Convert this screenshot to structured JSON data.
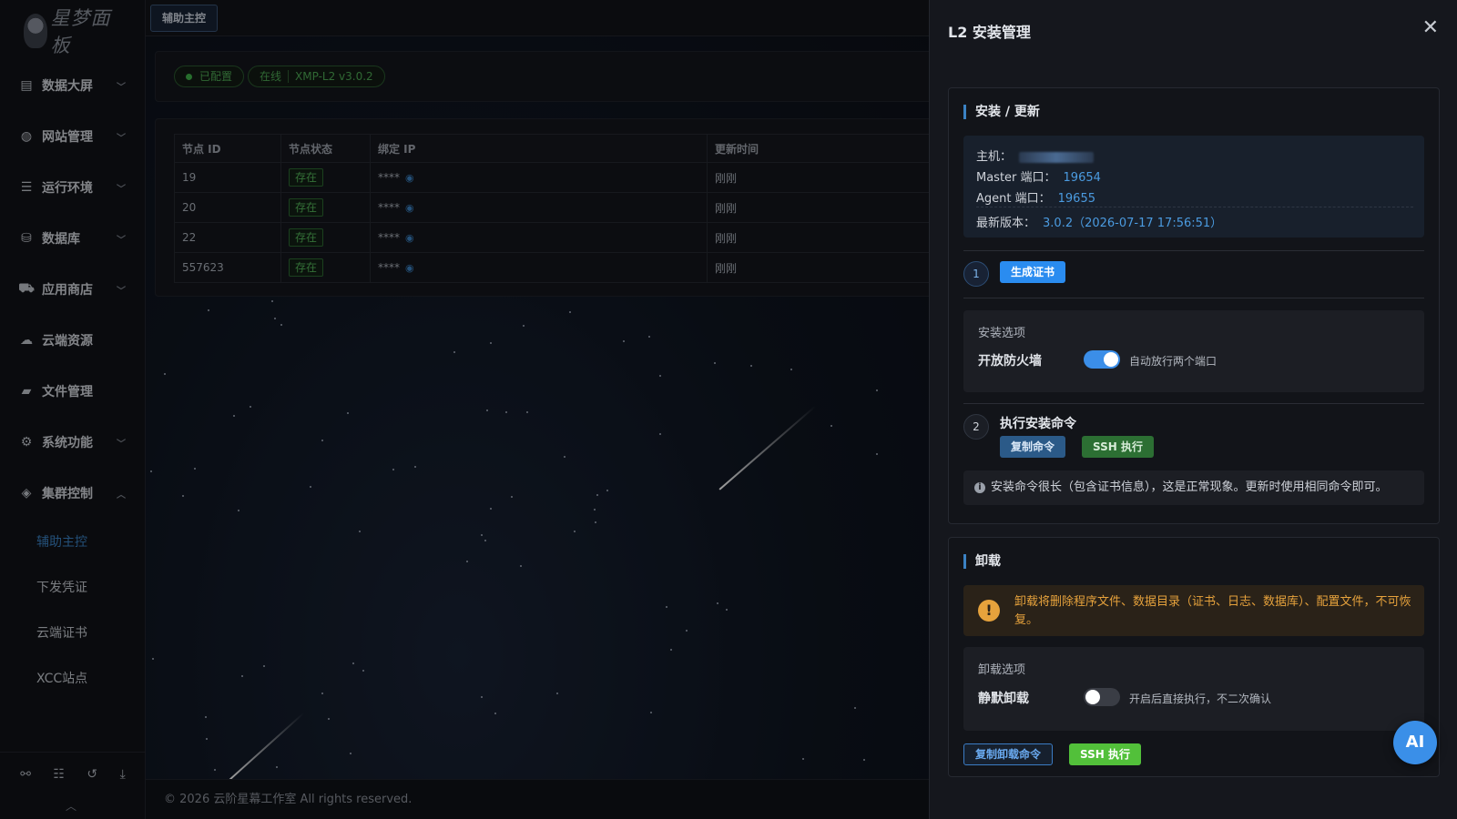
{
  "app": {
    "logo_text": "星梦面板"
  },
  "sidebar": {
    "items": [
      {
        "label": "数据大屏",
        "icon": "bar-chart-icon",
        "expandable": true
      },
      {
        "label": "网站管理",
        "icon": "globe-icon",
        "expandable": true
      },
      {
        "label": "运行环境",
        "icon": "server-icon",
        "expandable": true
      },
      {
        "label": "数据库",
        "icon": "database-icon",
        "expandable": true
      },
      {
        "label": "应用商店",
        "icon": "cart-icon",
        "expandable": true
      },
      {
        "label": "云端资源",
        "icon": "cloud-icon",
        "expandable": false
      },
      {
        "label": "文件管理",
        "icon": "folder-icon",
        "expandable": false
      },
      {
        "label": "系统功能",
        "icon": "gears-icon",
        "expandable": true
      },
      {
        "label": "集群控制",
        "icon": "layers-icon",
        "expandable": true,
        "expanded": true
      }
    ],
    "subitems": [
      {
        "label": "辅助主控",
        "active": true
      },
      {
        "label": "下发凭证",
        "active": false
      },
      {
        "label": "云端证书",
        "active": false
      },
      {
        "label": "XCC站点",
        "active": false
      }
    ],
    "bottom_icons": [
      "sitemap-icon",
      "list-icon",
      "history-icon",
      "download-icon"
    ]
  },
  "main": {
    "tab_label": "辅助主控",
    "status": {
      "configured": "已配置",
      "online": "在线",
      "version": "XMP-L2 v3.0.2"
    },
    "table": {
      "columns": [
        "节点 ID",
        "节点状态",
        "绑定 IP",
        "更新时间"
      ],
      "rows": [
        {
          "id": "19",
          "status": "存在",
          "ip": "****",
          "time": "刚刚"
        },
        {
          "id": "20",
          "status": "存在",
          "ip": "****",
          "time": "刚刚"
        },
        {
          "id": "22",
          "status": "存在",
          "ip": "****",
          "time": "刚刚"
        },
        {
          "id": "557623",
          "status": "存在",
          "ip": "****",
          "time": "刚刚"
        }
      ]
    },
    "footer": "© 2026 云阶星幕工作室 All rights reserved."
  },
  "drawer": {
    "title": "L2 安装管理",
    "install": {
      "section_title": "安装 / 更新",
      "host_label": "主机：",
      "master_port_label": "Master 端口：",
      "master_port": "19654",
      "agent_port_label": "Agent 端口：",
      "agent_port": "19655",
      "latest_label": "最新版本：",
      "latest_value": "3.0.2（2026-07-17 17:56:51）",
      "step1_num": "1",
      "gen_cert_btn": "生成证书",
      "options_title": "安装选项",
      "firewall_label": "开放防火墙",
      "firewall_on": true,
      "firewall_desc": "自动放行两个端口",
      "step2_num": "2",
      "step2_label": "执行安装命令",
      "copy_cmd_btn": "复制命令",
      "ssh_exec_btn": "SSH 执行",
      "note": "安装命令很长（包含证书信息），这是正常现象。更新时使用相同命令即可。"
    },
    "uninstall": {
      "section_title": "卸载",
      "warning": "卸载将删除程序文件、数据目录（证书、日志、数据库）、配置文件，不可恢复。",
      "options_title": "卸载选项",
      "silent_label": "静默卸载",
      "silent_on": false,
      "silent_desc": "开启后直接执行，不二次确认",
      "copy_uninstall_btn": "复制卸载命令",
      "ssh_exec_btn": "SSH 执行"
    },
    "ai_button": "AI"
  },
  "colors": {
    "accent": "#2a8cf0",
    "success": "#52c03a",
    "warning": "#e6a23c"
  }
}
